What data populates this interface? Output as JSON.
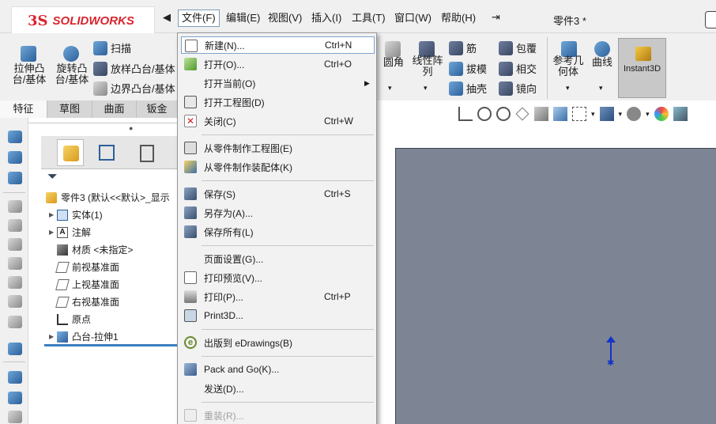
{
  "topbar": {
    "logo_prefix": "3S",
    "logo_text": "SOLIDWORKS",
    "nav_arrow": "◀",
    "menus": [
      "文件(F)",
      "编辑(E)",
      "视图(V)",
      "插入(I)",
      "工具(T)",
      "窗口(W)",
      "帮助(H)"
    ],
    "pin": "⇥",
    "doc_title": "零件3 *"
  },
  "commands": {
    "extrude_boss": "拉伸凸\n台/基体",
    "revolve_boss": "旋转凸\n台/基体",
    "sweep": "扫描",
    "loft": "放样凸台/基体",
    "boundary": "边界凸台/基体",
    "fillet": "圆角",
    "linear_pattern": "线性阵\n列",
    "rib": "筋",
    "wrap": "包覆",
    "draft": "拔模",
    "intersect": "相交",
    "shell": "抽壳",
    "mirror": "镜向",
    "ref_geometry": "参考几\n何体",
    "curves": "曲线",
    "instant3d": "Instant3D"
  },
  "tabs": [
    "特征",
    "草图",
    "曲面",
    "钣金"
  ],
  "tree": {
    "root": "零件3  (默认<<默认>_显示",
    "items": [
      {
        "label": "实体(1)",
        "expandable": true
      },
      {
        "label": "注解",
        "expandable": true
      },
      {
        "label": "材质 <未指定>",
        "expandable": false
      },
      {
        "label": "前视基准面",
        "expandable": false
      },
      {
        "label": "上视基准面",
        "expandable": false
      },
      {
        "label": "右视基准面",
        "expandable": false
      },
      {
        "label": "原点",
        "expandable": false
      },
      {
        "label": "凸台-拉伸1",
        "expandable": true
      }
    ]
  },
  "file_menu": {
    "items": [
      {
        "label": "新建(N)...",
        "shortcut": "Ctrl+N",
        "icon": "new-document-icon",
        "highlight": true
      },
      {
        "label": "打开(O)...",
        "shortcut": "Ctrl+O",
        "icon": "open-folder-icon"
      },
      {
        "label": "打开当前(O)",
        "shortcut": "",
        "icon": "",
        "submenu": true
      },
      {
        "label": "打开工程图(D)",
        "shortcut": "",
        "icon": "open-drawing-icon"
      },
      {
        "label": "关闭(C)",
        "shortcut": "Ctrl+W",
        "icon": "close-document-icon"
      },
      {
        "label": "从零件制作工程图(E)",
        "shortcut": "",
        "icon": "make-drawing-icon"
      },
      {
        "label": "从零件制作装配体(K)",
        "shortcut": "",
        "icon": "make-assembly-icon"
      },
      {
        "label": "保存(S)",
        "shortcut": "Ctrl+S",
        "icon": "save-icon"
      },
      {
        "label": "另存为(A)...",
        "shortcut": "",
        "icon": "save-as-icon"
      },
      {
        "label": "保存所有(L)",
        "shortcut": "",
        "icon": "save-all-icon"
      },
      {
        "label": "页面设置(G)...",
        "shortcut": "",
        "icon": ""
      },
      {
        "label": "打印预览(V)...",
        "shortcut": "",
        "icon": "print-preview-icon"
      },
      {
        "label": "打印(P)...",
        "shortcut": "Ctrl+P",
        "icon": "print-icon"
      },
      {
        "label": "Print3D...",
        "shortcut": "",
        "icon": "print3d-icon"
      },
      {
        "label": "出版到 eDrawings(B)",
        "shortcut": "",
        "icon": "edrawings-icon"
      },
      {
        "label": "Pack and Go(K)...",
        "shortcut": "",
        "icon": "pack-and-go-icon"
      },
      {
        "label": "发送(D)...",
        "shortcut": "",
        "icon": ""
      },
      {
        "label": "重装(R)...",
        "shortcut": "",
        "icon": "reload-icon",
        "disabled": true
      }
    ]
  },
  "colors": {
    "brand_red": "#d8242e",
    "viewport": "#7d8494",
    "highlight_border": "#7da2ce",
    "origin_blue": "#1233c8"
  }
}
